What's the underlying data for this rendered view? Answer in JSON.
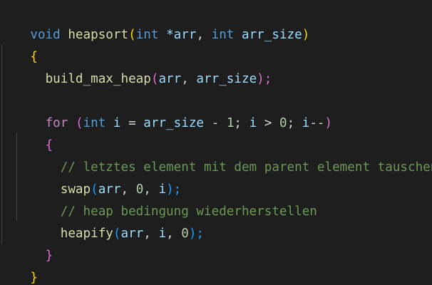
{
  "editor": {
    "lines": [
      {
        "tokens": [
          "void",
          " ",
          "heapsort",
          "(",
          "int",
          " ",
          "*arr",
          ", ",
          "int",
          " ",
          "arr_size",
          ")"
        ]
      },
      {
        "tokens": [
          "{"
        ]
      },
      {
        "tokens": [
          "  ",
          "build_max_heap",
          "(",
          "arr",
          ", ",
          "arr_size",
          ");"
        ]
      },
      {
        "tokens": [
          ""
        ]
      },
      {
        "tokens": [
          "  ",
          "for",
          " ",
          "(",
          "int",
          " ",
          "i",
          " = ",
          "arr_size",
          " - ",
          "1",
          "; ",
          "i",
          " > ",
          "0",
          "; ",
          "i",
          "--",
          ")"
        ]
      },
      {
        "tokens": [
          "  ",
          "{"
        ]
      },
      {
        "tokens": [
          "    ",
          "// letztes element mit dem parent element tauschen"
        ]
      },
      {
        "tokens": [
          "    ",
          "swap",
          "(",
          "arr",
          ", ",
          "0",
          ", ",
          "i",
          ");"
        ]
      },
      {
        "tokens": [
          "    ",
          "// heap bedingung wiederherstellen"
        ]
      },
      {
        "tokens": [
          "    ",
          "heapify",
          "(",
          "arr",
          ", ",
          "i",
          ", ",
          "0",
          ");"
        ]
      },
      {
        "tokens": [
          "  ",
          "}"
        ]
      },
      {
        "tokens": [
          "}"
        ]
      }
    ]
  },
  "colors": {
    "background": "#1e1e1e",
    "keyword": "#569cd6",
    "control_keyword": "#c586c0",
    "function": "#dcdcaa",
    "variable": "#9cdcfe",
    "number": "#b5cea8",
    "comment": "#6a9955",
    "bracket_level1": "#ffd700",
    "bracket_level2": "#da70d6",
    "bracket_level3": "#179fff"
  }
}
